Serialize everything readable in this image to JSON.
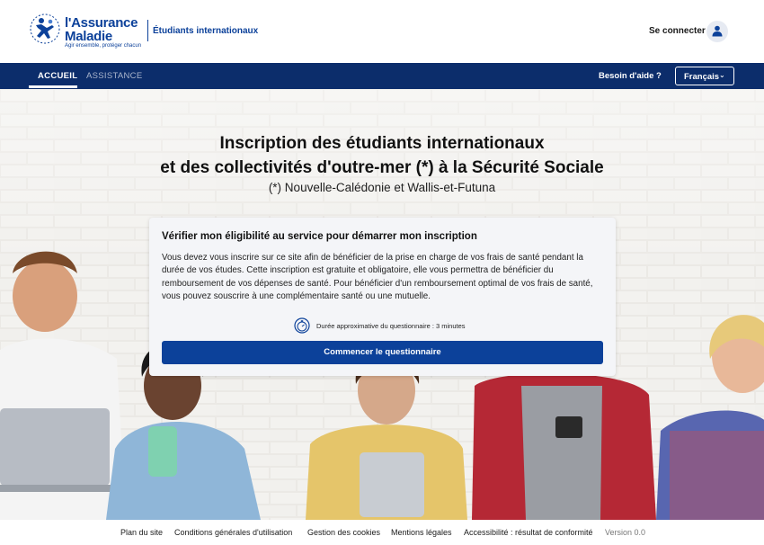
{
  "header": {
    "logo_line1": "l'Assurance",
    "logo_line2": "Maladie",
    "logo_tagline": "Agir ensemble, protéger chacun",
    "brand_subtitle": "Étudiants internationaux",
    "login_label": "Se connecter",
    "avatar_icon": "user-icon"
  },
  "nav": {
    "items": [
      {
        "label": "ACCUEIL",
        "active": true
      },
      {
        "label": "ASSISTANCE",
        "active": false
      }
    ],
    "help_label": "Besoin d'aide ?",
    "language_selected": "Français"
  },
  "hero": {
    "title_line1": "Inscription des étudiants internationaux",
    "title_line2": "et des collectivités d'outre-mer (*) à la Sécurité Sociale",
    "subtitle": "(*) Nouvelle-Calédonie et Wallis-et-Futuna"
  },
  "card": {
    "heading": "Vérifier mon éligibilité au service pour démarrer mon inscription",
    "body": "Vous devez vous inscrire sur ce site afin de bénéficier de la prise en charge de vos frais de santé pendant la durée de vos études. Cette inscription est gratuite et obligatoire, elle vous permettra de bénéficier du remboursement de vos dépenses de santé. Pour bénéficier d'un remboursement optimal de vos frais de santé, vous pouvez souscrire à une complémentaire santé ou une mutuelle.",
    "duration_text": "Durée approximative du questionnaire : 3 minutes",
    "duration_icon": "stopwatch-icon",
    "button_label": "Commencer le questionnaire"
  },
  "footer": {
    "links": [
      "Plan du site",
      "Conditions générales d'utilisation",
      "Gestion des cookies",
      "Mentions légales",
      "Accessibilité : résultat de conformité"
    ],
    "version": "Version 0.0"
  },
  "colors": {
    "brand_blue": "#0c419a",
    "nav_bg": "#0c2d6b",
    "card_bg": "#f4f5f8"
  }
}
